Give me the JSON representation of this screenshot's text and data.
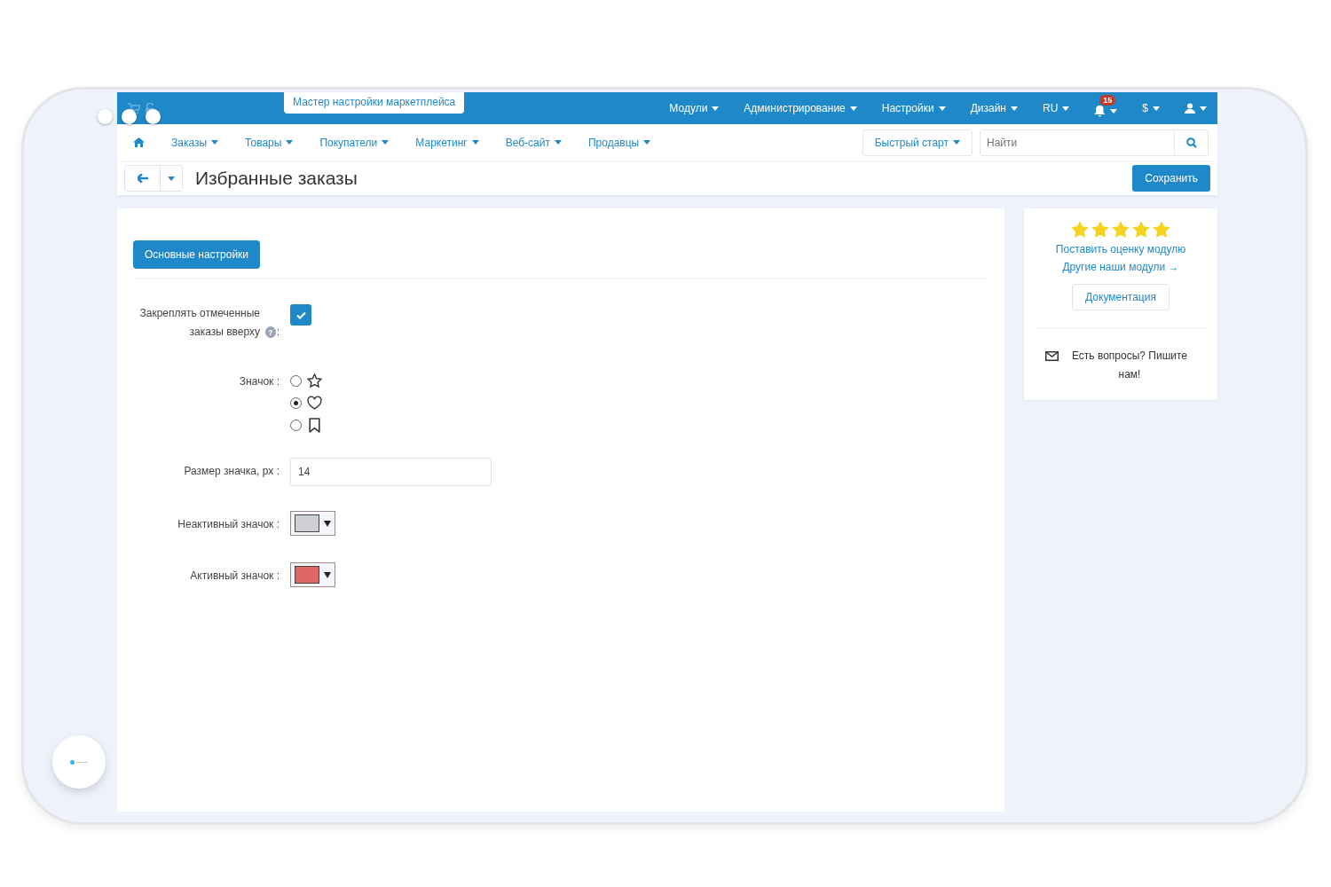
{
  "top_bar": {
    "wizard_button": "Мастер настройки маркетплейса",
    "menu": [
      {
        "label": "Модули",
        "kind": "text"
      },
      {
        "label": "Администрирование",
        "kind": "text"
      },
      {
        "label": "Настройки",
        "kind": "text"
      },
      {
        "label": "Дизайн",
        "kind": "text"
      },
      {
        "label": "RU",
        "kind": "text"
      },
      {
        "label": "15",
        "kind": "bell"
      },
      {
        "label": "$",
        "kind": "text"
      },
      {
        "kind": "user"
      }
    ]
  },
  "nav": {
    "items": [
      "Заказы",
      "Товары",
      "Покупатели",
      "Маркетинг",
      "Веб-сайт",
      "Продавцы"
    ],
    "quick_start": "Быстрый старт",
    "search": {
      "placeholder": "Найти"
    }
  },
  "page": {
    "title": "Избранные заказы",
    "save_button": "Сохранить"
  },
  "tabs": [
    {
      "label": "Основные настройки",
      "selected": true
    }
  ],
  "form": {
    "pin": {
      "label": "Закреплять отмеченные заказы вверху",
      "help_icon": "?",
      "colon": ":",
      "checked": true
    },
    "icon": {
      "label": "Значок :",
      "options": [
        {
          "kind": "star",
          "selected": false
        },
        {
          "kind": "heart",
          "selected": true
        },
        {
          "kind": "bookmark",
          "selected": false
        }
      ]
    },
    "size": {
      "label": "Размер значка, px :",
      "value": "14"
    },
    "colors": [
      {
        "label": "Неактивный значок :",
        "color": "#cfd0d6"
      },
      {
        "label": "Активный значок :",
        "color": "#e06666"
      }
    ]
  },
  "sidebar": {
    "stars": 5,
    "rate_link": "Поставить оценку модулю",
    "modules_link": "Другие наши модули →",
    "docs_button": "Документация",
    "contact": "Есть вопросы? Пишите нам!"
  }
}
